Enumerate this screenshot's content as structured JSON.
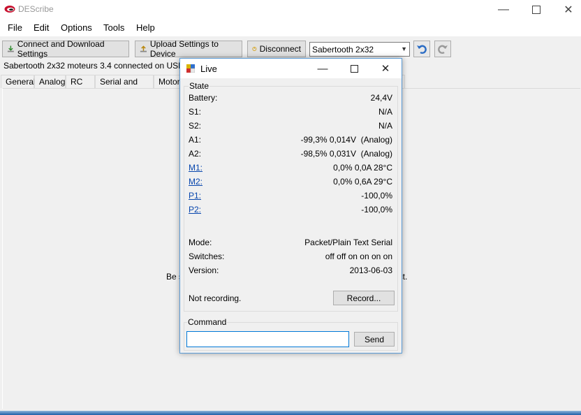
{
  "app": {
    "title": "DEScribe",
    "icon": "describe-logo-icon"
  },
  "menu": [
    "File",
    "Edit",
    "Options",
    "Tools",
    "Help"
  ],
  "toolbar": {
    "connect_label": "Connect and Download Settings",
    "upload_label": "Upload Settings to Device",
    "disconnect_label": "Disconnect",
    "device_selected": "Sabertooth 2x32"
  },
  "status": "Sabertooth 2x32 moteurs 3.4 connected on USB.",
  "tabs": [
    "General",
    "Analog",
    "RC",
    "Serial and USB",
    "Motor"
  ],
  "background_text": {
    "left": "Be s",
    "right": "ect."
  },
  "live": {
    "title": "Live",
    "state_legend": "State",
    "rows": [
      {
        "label": "Battery:",
        "value": "24,4V"
      },
      {
        "label": "S1:",
        "value": "N/A"
      },
      {
        "label": "S2:",
        "value": "N/A"
      },
      {
        "label": "A1:",
        "value": "-99,3% 0,014V  (Analog)"
      },
      {
        "label": "A2:",
        "value": "-98,5% 0,031V  (Analog)"
      },
      {
        "label": "M1:",
        "value": "0,0% 0,0A 28°C"
      },
      {
        "label": "M2:",
        "value": "0,0% 0,6A 29°C"
      },
      {
        "label": "P1:",
        "value": "-100,0%"
      },
      {
        "label": "P2:",
        "value": "-100,0%"
      }
    ],
    "info": [
      {
        "label": "Mode:",
        "value": "Packet/Plain Text Serial"
      },
      {
        "label": "Switches:",
        "value": "off off on on on on"
      },
      {
        "label": "Version:",
        "value": "2013-06-03"
      }
    ],
    "recording_status": "Not recording.",
    "record_label": "Record...",
    "command_legend": "Command",
    "command_value": "",
    "send_label": "Send"
  },
  "colors": {
    "link": "#0645ad",
    "focus_border": "#0078d7",
    "undo_icon": "#2b6cc4"
  }
}
